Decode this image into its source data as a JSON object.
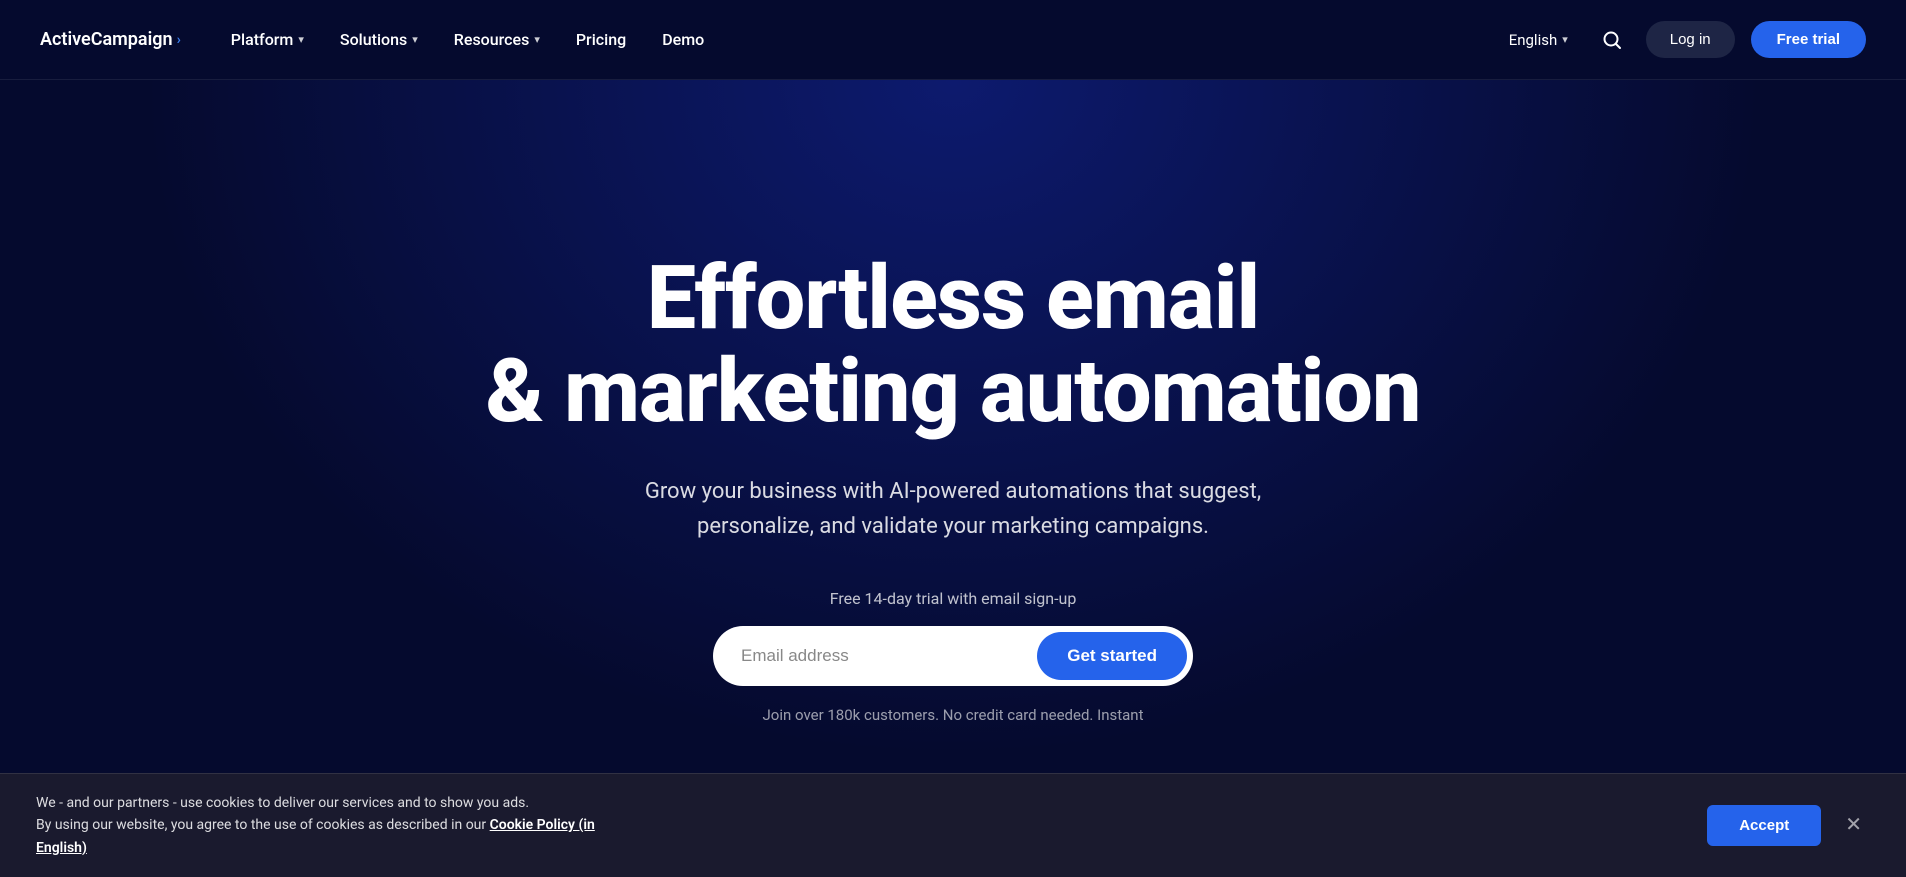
{
  "brand": {
    "logo_text": "ActiveCampaign",
    "logo_arrow": "›"
  },
  "nav": {
    "items": [
      {
        "label": "Platform",
        "has_chevron": true
      },
      {
        "label": "Solutions",
        "has_chevron": true
      },
      {
        "label": "Resources",
        "has_chevron": true
      },
      {
        "label": "Pricing",
        "has_chevron": false
      },
      {
        "label": "Demo",
        "has_chevron": false
      }
    ],
    "lang": "English",
    "login_label": "Log in",
    "free_trial_label": "Free trial"
  },
  "hero": {
    "title_line1": "Effortless email",
    "title_line2": "& marketing automation",
    "subtitle": "Grow your business with AI-powered automations that suggest, personalize, and validate your marketing campaigns.",
    "trial_note": "Free 14-day trial with email sign-up",
    "email_placeholder": "Email address",
    "cta_button": "Get started",
    "join_text": "Join over 180k customers. No credit card needed. Instant"
  },
  "cookie": {
    "text_line1": "We - and our partners - use cookies to deliver our services and to show you ads.",
    "text_line2": "By using our website, you agree to the use of cookies as described in our",
    "link_text": "Cookie Policy (in English)",
    "accept_label": "Accept"
  }
}
